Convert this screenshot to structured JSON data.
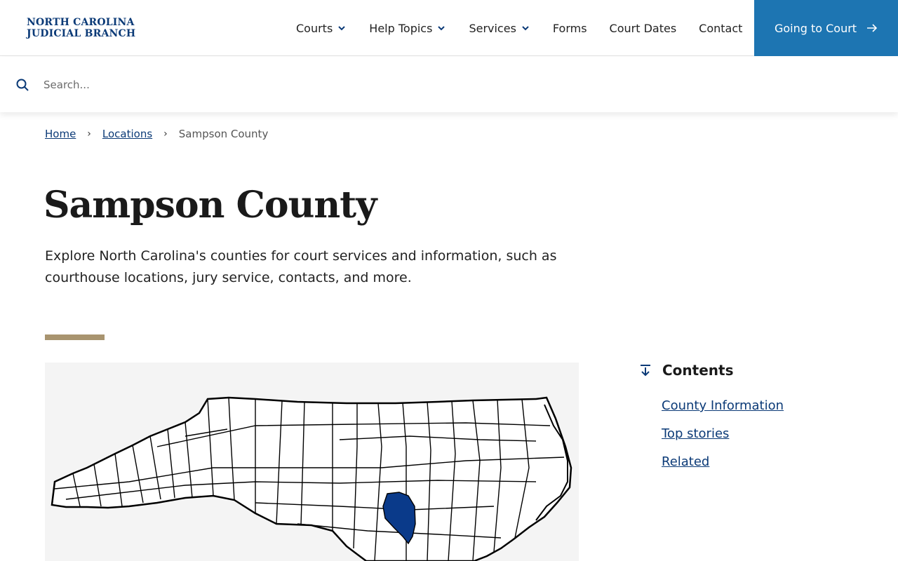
{
  "header": {
    "logo_line1": "NORTH CAROLINA",
    "logo_line2": "JUDICIAL BRANCH",
    "nav": [
      {
        "label": "Courts",
        "has_dropdown": true
      },
      {
        "label": "Help Topics",
        "has_dropdown": true
      },
      {
        "label": "Services",
        "has_dropdown": true
      },
      {
        "label": "Forms",
        "has_dropdown": false
      },
      {
        "label": "Court Dates",
        "has_dropdown": false
      },
      {
        "label": "Contact",
        "has_dropdown": false
      }
    ],
    "cta_label": "Going to Court"
  },
  "search": {
    "placeholder": "Search...",
    "value": ""
  },
  "breadcrumb": {
    "home": "Home",
    "locations": "Locations",
    "current": "Sampson County"
  },
  "page": {
    "title": "Sampson County",
    "intro": "Explore North Carolina's counties for court services and information, such as courthouse locations, jury service, contacts, and more."
  },
  "contents": {
    "heading": "Contents",
    "links": [
      "County Information",
      "Top stories",
      "Related"
    ]
  },
  "colors": {
    "brand_blue": "#0b3a77",
    "cta_blue": "#1d75b2",
    "accent_gold": "#a8946f",
    "highlight_county": "#0a3a8a"
  },
  "icons": {
    "search": "search-icon",
    "chevron": "chevron-down-icon",
    "arrow": "arrow-right-icon",
    "contents": "arrow-down-to-line-icon"
  }
}
